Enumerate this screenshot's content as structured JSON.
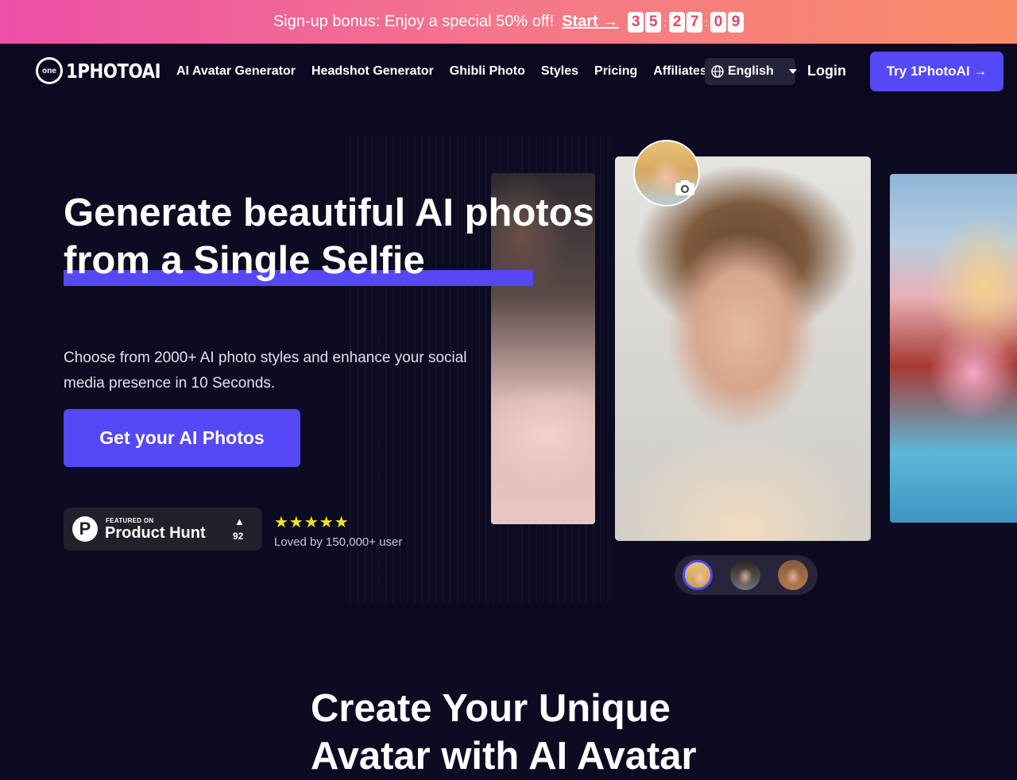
{
  "banner": {
    "text": "Sign-up bonus: Enjoy a special 50% off!",
    "cta": "Start →",
    "countdown": [
      "3",
      "5",
      "2",
      "7",
      "0",
      "9"
    ],
    "colors": {
      "from": "#ec4fa7",
      "to": "#fb8c67"
    }
  },
  "nav": {
    "logo_badge": "one",
    "logo_text": "1PHOTOAI",
    "links": [
      "AI Avatar Generator",
      "Headshot Generator",
      "Ghibli Photo",
      "Styles",
      "Pricing",
      "Affiliates"
    ],
    "language": "English",
    "language_icon": "globe-icon",
    "login": "Login",
    "try_button": "Try 1PhotoAI →"
  },
  "hero": {
    "title_line1": "Generate beautiful AI photos",
    "title_line2": "from a Single Selfie",
    "subtitle": "Choose from 2000+ AI photo styles and enhance your social media presence in 10 Seconds.",
    "cta": "Get your AI Photos",
    "accent_color": "#5548f7"
  },
  "product_hunt": {
    "logo_letter": "P",
    "featured": "FEATURED ON",
    "name": "Product Hunt",
    "upvote_icon": "▲",
    "count": "92"
  },
  "rating": {
    "stars": "★★★★★",
    "stars_count": 5,
    "text": "Loved by 150,000+ user"
  },
  "gallery": {
    "camera_icon": "camera-icon",
    "thumbnails": 3,
    "selected_thumbnail": 1
  },
  "section": {
    "title": "Create Your Unique Avatar with AI Avatar"
  }
}
